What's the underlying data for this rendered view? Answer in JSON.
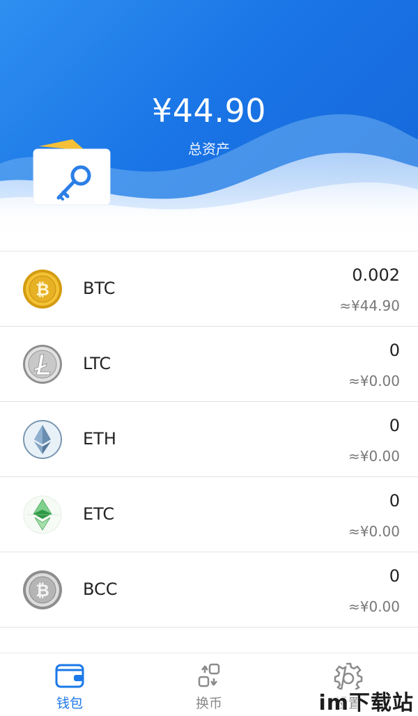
{
  "header": {
    "total_amount": "¥44.90",
    "total_label": "总资产"
  },
  "coins": [
    {
      "symbol": "BTC",
      "amount": "0.002",
      "value": "≈¥44.90",
      "icon": "bitcoin-gold-coin-icon",
      "color": "#e8b221"
    },
    {
      "symbol": "LTC",
      "amount": "0",
      "value": "≈¥0.00",
      "icon": "litecoin-silver-coin-icon",
      "color": "#b8b8b8"
    },
    {
      "symbol": "ETH",
      "amount": "0",
      "value": "≈¥0.00",
      "icon": "ethereum-coin-icon",
      "color": "#6f8faa"
    },
    {
      "symbol": "ETC",
      "amount": "0",
      "value": "≈¥0.00",
      "icon": "ethereum-classic-coin-icon",
      "color": "#3aa654"
    },
    {
      "symbol": "BCC",
      "amount": "0",
      "value": "≈¥0.00",
      "icon": "bitcoin-cash-silver-coin-icon",
      "color": "#a8a8a8"
    }
  ],
  "nav": {
    "items": [
      {
        "label": "钱包",
        "icon": "wallet-icon",
        "active": true
      },
      {
        "label": "换币",
        "icon": "exchange-icon",
        "active": false
      },
      {
        "label": "设置",
        "icon": "gear-icon",
        "active": false
      }
    ]
  },
  "watermark": "im下载站",
  "colors": {
    "accent": "#1a78e8",
    "header_blue": "#1a75e6",
    "inactive_nav": "#8a8a8a"
  }
}
